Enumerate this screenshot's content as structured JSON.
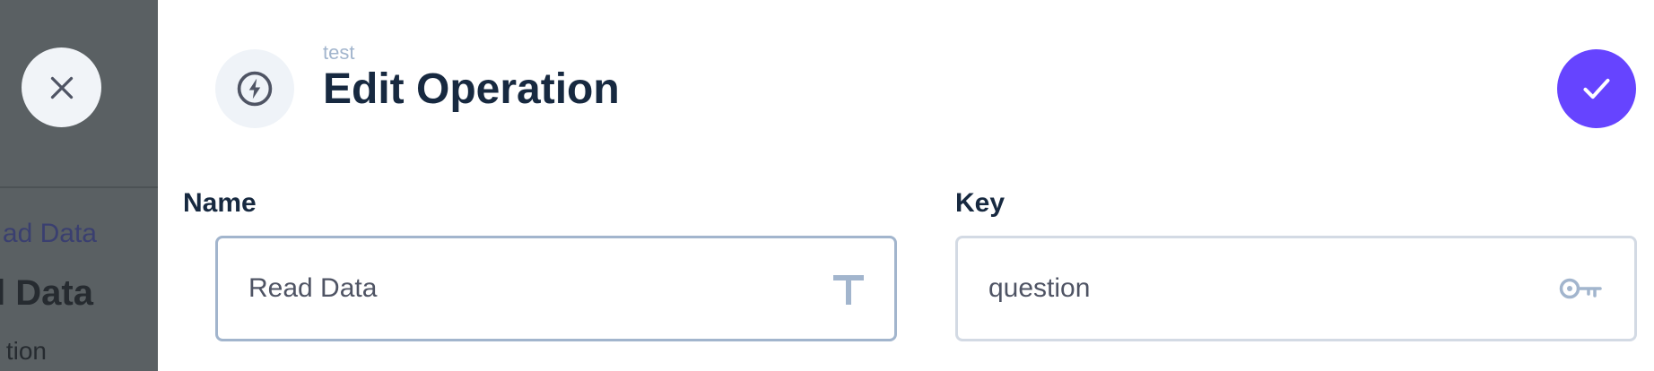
{
  "backdrop": {
    "breadcrumb": "ad Data",
    "title": "l Data",
    "subtitle": "tion"
  },
  "header": {
    "breadcrumb": "test",
    "title": "Edit Operation",
    "icon": "bolt-icon"
  },
  "actions": {
    "close_icon": "close-icon",
    "save_icon": "check-icon"
  },
  "form": {
    "name": {
      "label": "Name",
      "value": "Read Data",
      "icon": "text-icon"
    },
    "key": {
      "label": "Key",
      "value": "question",
      "icon": "key-icon"
    }
  },
  "colors": {
    "accent": "#6644ff",
    "backdrop": "#5a6063",
    "title": "#172940",
    "muted": "#a2b5cd"
  }
}
